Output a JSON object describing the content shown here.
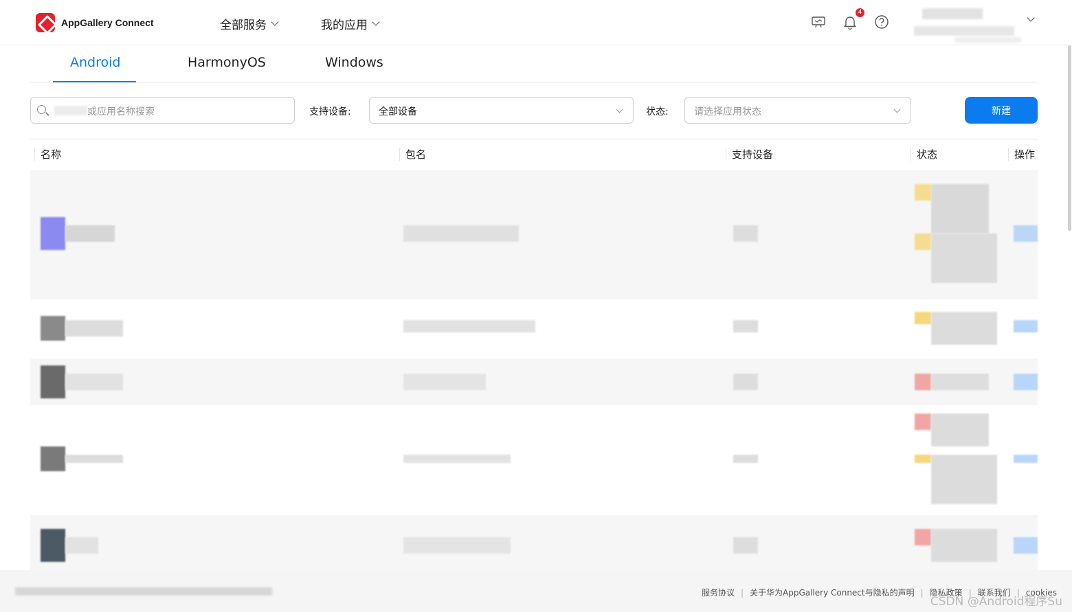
{
  "header": {
    "app_name": "AppGallery Connect",
    "menu_all_services": "全部服务",
    "menu_my_apps": "我的应用",
    "notification_count": "4"
  },
  "tabs": [
    {
      "label": "Android",
      "active": true
    },
    {
      "label": "HarmonyOS",
      "active": false
    },
    {
      "label": "Windows",
      "active": false
    }
  ],
  "filters": {
    "search_placeholder": "或应用名称搜索",
    "device_label": "支持设备:",
    "device_value": "全部设备",
    "status_label": "状态:",
    "status_placeholder": "请选择应用状态",
    "new_button": "新建"
  },
  "table": {
    "columns": [
      "名称",
      "包名",
      "支持设备",
      "状态",
      "操作"
    ]
  },
  "footer": {
    "links": [
      "服务协议",
      "关于华为AppGallery Connect与隐私的声明",
      "隐私政策",
      "联系我们",
      "cookies"
    ],
    "watermark": "CSDN @Android程序Su"
  },
  "colors": {
    "accent": "#0a7cf0",
    "brand_red": "#e8202b"
  }
}
